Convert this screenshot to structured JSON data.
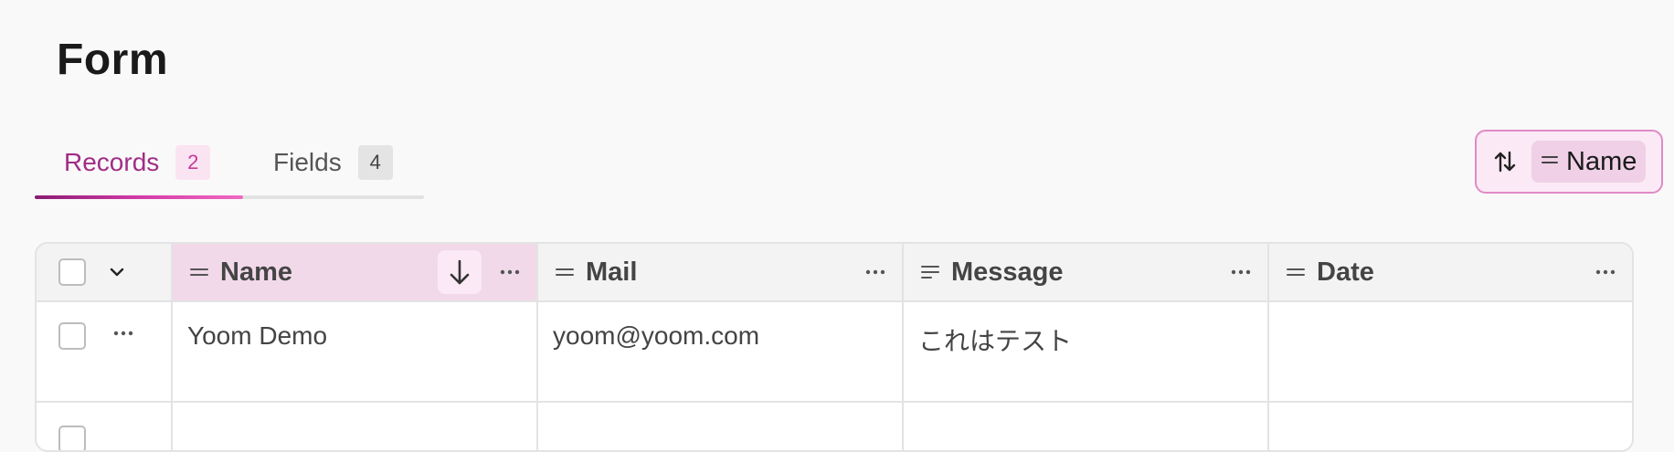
{
  "page": {
    "title": "Form"
  },
  "tabs": [
    {
      "label": "Records",
      "count": "2",
      "active": true
    },
    {
      "label": "Fields",
      "count": "4",
      "active": false
    }
  ],
  "sort": {
    "icon": "sort-arrows-icon",
    "field_icon": "short-text-icon",
    "field": "Name"
  },
  "table": {
    "columns": [
      {
        "label": "Name",
        "icon": "short-text-icon",
        "sorted": "descending"
      },
      {
        "label": "Mail",
        "icon": "short-text-icon"
      },
      {
        "label": "Message",
        "icon": "long-text-icon"
      },
      {
        "label": "Date",
        "icon": "short-text-icon"
      }
    ],
    "rows": [
      {
        "name": "Yoom Demo",
        "mail": "yoom@yoom.com",
        "message": "これはテスト",
        "date": ""
      },
      {
        "name": "",
        "mail": "",
        "message": "",
        "date": ""
      }
    ]
  },
  "colors": {
    "accent": "#a12d86",
    "accent_light": "#fbe4f2",
    "sorted_header": "#f1d9ea"
  }
}
